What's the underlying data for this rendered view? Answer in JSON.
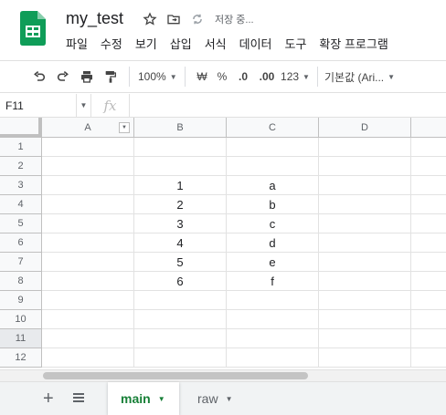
{
  "header": {
    "doc_title": "my_test",
    "saving_status": "저장 중...",
    "menu": [
      "파일",
      "수정",
      "보기",
      "삽입",
      "서식",
      "데이터",
      "도구",
      "확장 프로그램"
    ]
  },
  "toolbar": {
    "zoom": "100%",
    "currency": "₩",
    "percent": "%",
    "decrease_decimal": ".0",
    "increase_decimal": ".00",
    "number_format": "123",
    "font": "기본값 (Ari..."
  },
  "formula_bar": {
    "name_box": "F11",
    "fx_label": "fx",
    "formula_value": ""
  },
  "grid": {
    "columns": [
      "A",
      "B",
      "C",
      "D"
    ],
    "rows": [
      "1",
      "2",
      "3",
      "4",
      "5",
      "6",
      "7",
      "8",
      "9",
      "10",
      "11",
      "12"
    ],
    "active_row": "11",
    "cells": {
      "B3": "1",
      "C3": "a",
      "B4": "2",
      "C4": "b",
      "B5": "3",
      "C5": "c",
      "B6": "4",
      "C6": "d",
      "B7": "5",
      "C7": "e",
      "B8": "6",
      "C8": "f"
    }
  },
  "sheets": {
    "tabs": [
      {
        "label": "main",
        "active": true
      },
      {
        "label": "raw",
        "active": false
      }
    ]
  },
  "colors": {
    "accent": "#188038",
    "logo": "#0f9d58"
  }
}
